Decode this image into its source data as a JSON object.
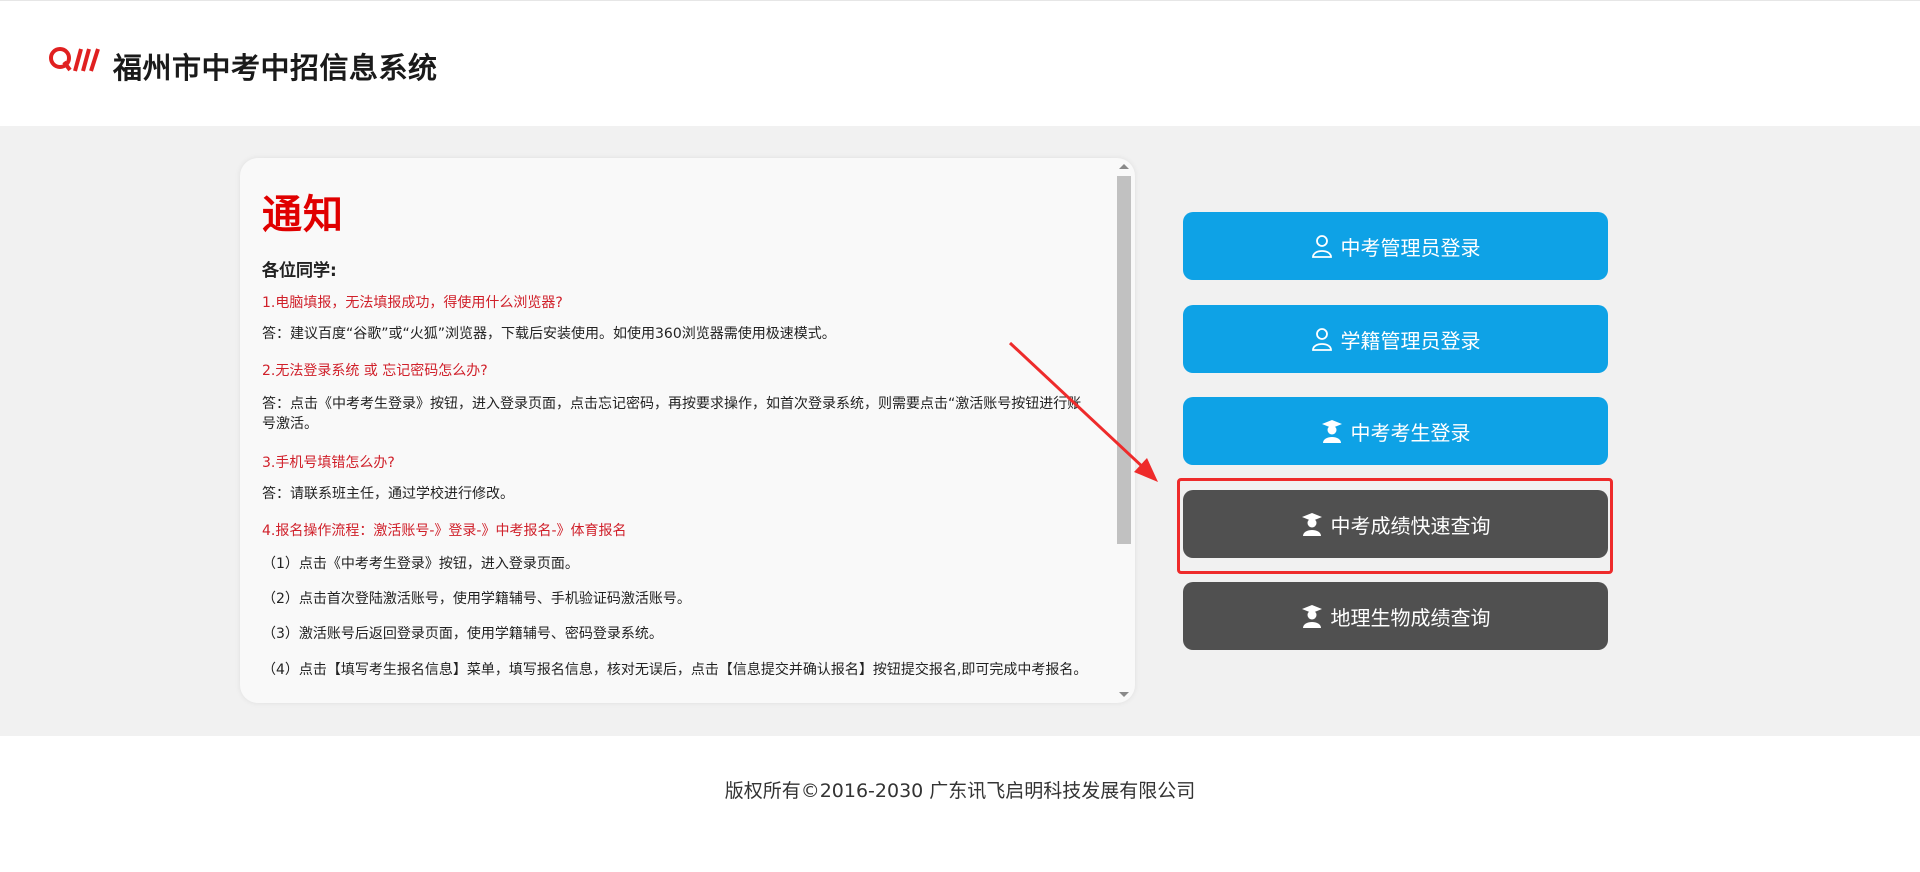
{
  "header": {
    "logo_text": "QW",
    "title": "福州市中考中招信息系统"
  },
  "notice": {
    "title": "通知",
    "greeting": "各位同学:",
    "items": [
      {
        "q": "1.电脑填报，无法填报成功，得使用什么浏览器?",
        "a": "答：建议百度“谷歌”或“火狐”浏览器，下载后安装使用。如使用360浏览器需使用极速模式。"
      },
      {
        "q": "2.无法登录系统 或 忘记密码怎么办?",
        "a": "答：点击《中考考生登录》按钮，进入登录页面，点击忘记密码，再按要求操作，如首次登录系统，则需要点击“激活账号按钮进行账号激活。"
      },
      {
        "q": "3.手机号填错怎么办?",
        "a": "答：请联系班主任，通过学校进行修改。"
      },
      {
        "q": "4.报名操作流程：激活账号-》登录-》中考报名-》体育报名",
        "a": ""
      }
    ],
    "steps": [
      "（1）点击《中考考生登录》按钮，进入登录页面。",
      "（2）点击首次登陆激活账号，使用学籍辅号、手机验证码激活账号。",
      "（3）激活账号后返回登录页面，使用学籍辅号、密码登录系统。",
      "（4）点击【填写考生报名信息】菜单，填写报名信息，核对无误后，点击【信息提交并确认报名】按钮提交报名,即可完成中考报名。"
    ]
  },
  "buttons": {
    "admin_login": "中考管理员登录",
    "registry_login": "学籍管理员登录",
    "student_login": "中考考生登录",
    "quick_score": "中考成绩快速查询",
    "geo_bio_score": "地理生物成绩查询"
  },
  "colors": {
    "blue_button": "#0ea2e6",
    "dark_button": "#505050",
    "notice_red": "#e00000",
    "highlight_red": "#ee2b2b"
  },
  "footer": {
    "copyright": "版权所有©2016-2030 广东讯飞启明科技发展有限公司"
  }
}
